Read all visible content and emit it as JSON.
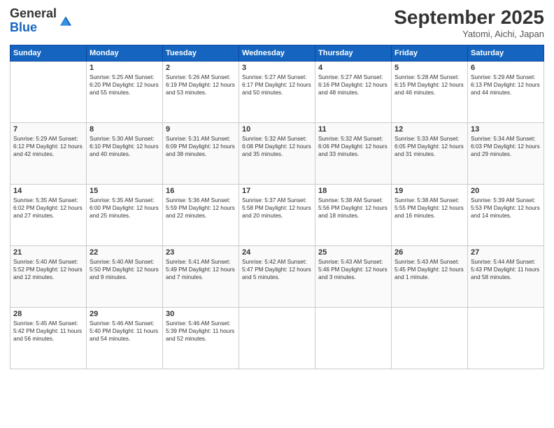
{
  "header": {
    "logo_general": "General",
    "logo_blue": "Blue",
    "month": "September 2025",
    "location": "Yatomi, Aichi, Japan"
  },
  "columns": [
    "Sunday",
    "Monday",
    "Tuesday",
    "Wednesday",
    "Thursday",
    "Friday",
    "Saturday"
  ],
  "weeks": [
    [
      {
        "day": "",
        "info": ""
      },
      {
        "day": "1",
        "info": "Sunrise: 5:25 AM\nSunset: 6:20 PM\nDaylight: 12 hours\nand 55 minutes."
      },
      {
        "day": "2",
        "info": "Sunrise: 5:26 AM\nSunset: 6:19 PM\nDaylight: 12 hours\nand 53 minutes."
      },
      {
        "day": "3",
        "info": "Sunrise: 5:27 AM\nSunset: 6:17 PM\nDaylight: 12 hours\nand 50 minutes."
      },
      {
        "day": "4",
        "info": "Sunrise: 5:27 AM\nSunset: 6:16 PM\nDaylight: 12 hours\nand 48 minutes."
      },
      {
        "day": "5",
        "info": "Sunrise: 5:28 AM\nSunset: 6:15 PM\nDaylight: 12 hours\nand 46 minutes."
      },
      {
        "day": "6",
        "info": "Sunrise: 5:29 AM\nSunset: 6:13 PM\nDaylight: 12 hours\nand 44 minutes."
      }
    ],
    [
      {
        "day": "7",
        "info": "Sunrise: 5:29 AM\nSunset: 6:12 PM\nDaylight: 12 hours\nand 42 minutes."
      },
      {
        "day": "8",
        "info": "Sunrise: 5:30 AM\nSunset: 6:10 PM\nDaylight: 12 hours\nand 40 minutes."
      },
      {
        "day": "9",
        "info": "Sunrise: 5:31 AM\nSunset: 6:09 PM\nDaylight: 12 hours\nand 38 minutes."
      },
      {
        "day": "10",
        "info": "Sunrise: 5:32 AM\nSunset: 6:08 PM\nDaylight: 12 hours\nand 35 minutes."
      },
      {
        "day": "11",
        "info": "Sunrise: 5:32 AM\nSunset: 6:06 PM\nDaylight: 12 hours\nand 33 minutes."
      },
      {
        "day": "12",
        "info": "Sunrise: 5:33 AM\nSunset: 6:05 PM\nDaylight: 12 hours\nand 31 minutes."
      },
      {
        "day": "13",
        "info": "Sunrise: 5:34 AM\nSunset: 6:03 PM\nDaylight: 12 hours\nand 29 minutes."
      }
    ],
    [
      {
        "day": "14",
        "info": "Sunrise: 5:35 AM\nSunset: 6:02 PM\nDaylight: 12 hours\nand 27 minutes."
      },
      {
        "day": "15",
        "info": "Sunrise: 5:35 AM\nSunset: 6:00 PM\nDaylight: 12 hours\nand 25 minutes."
      },
      {
        "day": "16",
        "info": "Sunrise: 5:36 AM\nSunset: 5:59 PM\nDaylight: 12 hours\nand 22 minutes."
      },
      {
        "day": "17",
        "info": "Sunrise: 5:37 AM\nSunset: 5:58 PM\nDaylight: 12 hours\nand 20 minutes."
      },
      {
        "day": "18",
        "info": "Sunrise: 5:38 AM\nSunset: 5:56 PM\nDaylight: 12 hours\nand 18 minutes."
      },
      {
        "day": "19",
        "info": "Sunrise: 5:38 AM\nSunset: 5:55 PM\nDaylight: 12 hours\nand 16 minutes."
      },
      {
        "day": "20",
        "info": "Sunrise: 5:39 AM\nSunset: 5:53 PM\nDaylight: 12 hours\nand 14 minutes."
      }
    ],
    [
      {
        "day": "21",
        "info": "Sunrise: 5:40 AM\nSunset: 5:52 PM\nDaylight: 12 hours\nand 12 minutes."
      },
      {
        "day": "22",
        "info": "Sunrise: 5:40 AM\nSunset: 5:50 PM\nDaylight: 12 hours\nand 9 minutes."
      },
      {
        "day": "23",
        "info": "Sunrise: 5:41 AM\nSunset: 5:49 PM\nDaylight: 12 hours\nand 7 minutes."
      },
      {
        "day": "24",
        "info": "Sunrise: 5:42 AM\nSunset: 5:47 PM\nDaylight: 12 hours\nand 5 minutes."
      },
      {
        "day": "25",
        "info": "Sunrise: 5:43 AM\nSunset: 5:46 PM\nDaylight: 12 hours\nand 3 minutes."
      },
      {
        "day": "26",
        "info": "Sunrise: 5:43 AM\nSunset: 5:45 PM\nDaylight: 12 hours\nand 1 minute."
      },
      {
        "day": "27",
        "info": "Sunrise: 5:44 AM\nSunset: 5:43 PM\nDaylight: 11 hours\nand 58 minutes."
      }
    ],
    [
      {
        "day": "28",
        "info": "Sunrise: 5:45 AM\nSunset: 5:42 PM\nDaylight: 11 hours\nand 56 minutes."
      },
      {
        "day": "29",
        "info": "Sunrise: 5:46 AM\nSunset: 5:40 PM\nDaylight: 11 hours\nand 54 minutes."
      },
      {
        "day": "30",
        "info": "Sunrise: 5:46 AM\nSunset: 5:39 PM\nDaylight: 11 hours\nand 52 minutes."
      },
      {
        "day": "",
        "info": ""
      },
      {
        "day": "",
        "info": ""
      },
      {
        "day": "",
        "info": ""
      },
      {
        "day": "",
        "info": ""
      }
    ]
  ]
}
